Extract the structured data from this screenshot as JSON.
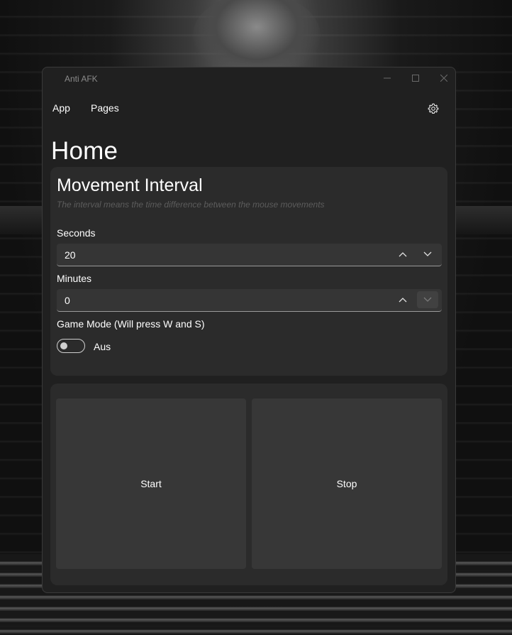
{
  "window": {
    "title": "Anti AFK"
  },
  "menu": {
    "items": [
      {
        "label": "App"
      },
      {
        "label": "Pages"
      }
    ],
    "settings_icon": "gear-icon"
  },
  "page": {
    "title": "Home"
  },
  "interval": {
    "title": "Movement Interval",
    "description": "The interval means the time difference between the mouse movements",
    "seconds": {
      "label": "Seconds",
      "value": "20"
    },
    "minutes": {
      "label": "Minutes",
      "value": "0"
    },
    "game_mode": {
      "label": "Game Mode (Will press W and S)",
      "state_label": "Aus",
      "on": false
    }
  },
  "actions": {
    "start_label": "Start",
    "stop_label": "Stop"
  },
  "colors": {
    "window_bg": "#202020",
    "card_bg": "#2b2b2b",
    "input_bg": "#353535",
    "button_bg": "#373737"
  }
}
